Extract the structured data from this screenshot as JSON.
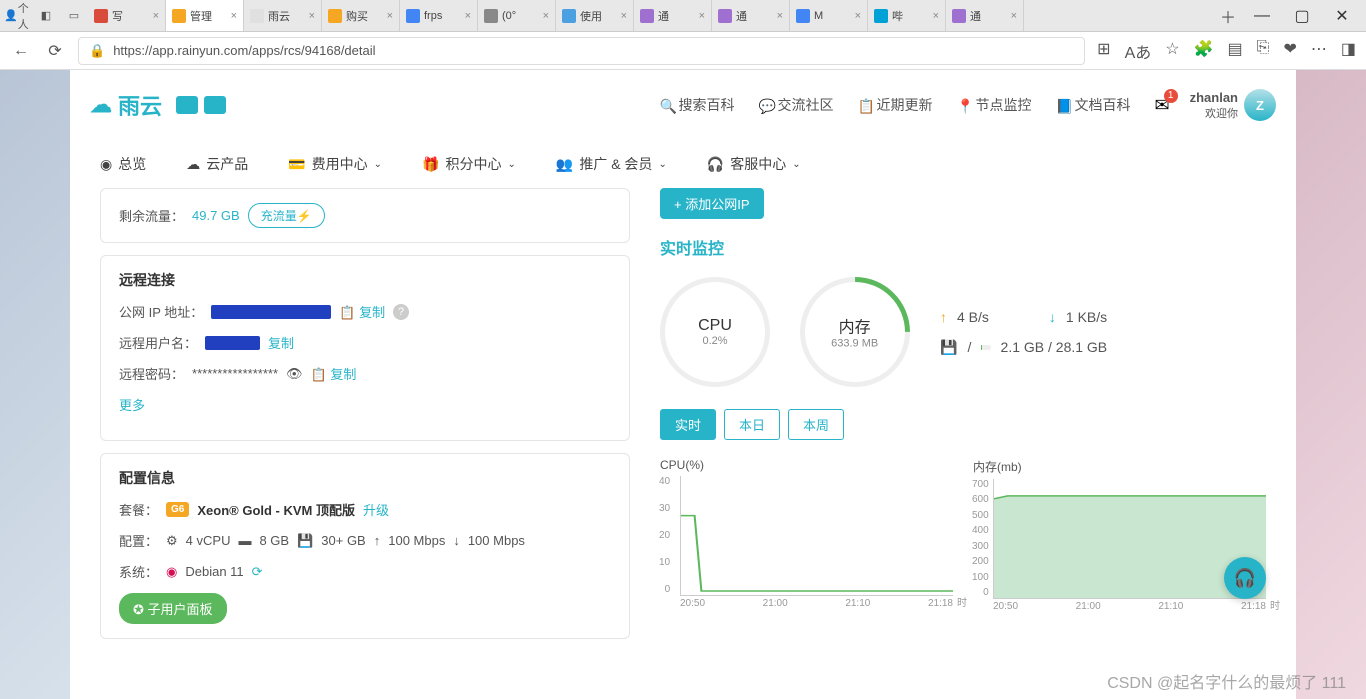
{
  "browser": {
    "profile": "个人",
    "tabs": [
      {
        "title": "写",
        "fav": "#d94b3b"
      },
      {
        "title": "管理",
        "fav": "#f5a623",
        "active": true
      },
      {
        "title": "雨云",
        "fav": "#e0e0e0"
      },
      {
        "title": "购买",
        "fav": "#f5a623"
      },
      {
        "title": "frps",
        "fav": "#4285f4"
      },
      {
        "title": "(0°",
        "fav": "#888"
      },
      {
        "title": "使用",
        "fav": "#4aa0e0"
      },
      {
        "title": "通",
        "fav": "#a070d0"
      },
      {
        "title": "通",
        "fav": "#a070d0"
      },
      {
        "title": "M",
        "fav": "#4285f4"
      },
      {
        "title": "哔",
        "fav": "#00a1d6"
      },
      {
        "title": "通",
        "fav": "#a070d0"
      }
    ],
    "url": "https://app.rainyun.com/apps/rcs/94168/detail"
  },
  "header": {
    "brand": "雨云",
    "links": [
      "搜索百科",
      "交流社区",
      "近期更新",
      "节点监控",
      "文档百科"
    ],
    "mailBadge": "1",
    "username": "zhanlan",
    "welcome": "欢迎你"
  },
  "subnav": [
    "总览",
    "云产品",
    "费用中心",
    "积分中心",
    "推广 & 会员",
    "客服中心"
  ],
  "left": {
    "traffic": {
      "label": "剩余流量：",
      "value": "49.7 GB",
      "btn": "充流量⚡"
    },
    "remote": {
      "title": "远程连接",
      "ipLabel": "公网 IP 地址：",
      "ipCopy": "复制",
      "userLabel": "远程用户名：",
      "userCopy": "复制",
      "pwdLabel": "远程密码：",
      "pwdMask": "*****************",
      "pwdCopy": "复制",
      "more": "更多"
    },
    "config": {
      "title": "配置信息",
      "planLabel": "套餐：",
      "g6": "G6",
      "planName": "Xeon® Gold - KVM 顶配版",
      "upgrade": "升级",
      "hwLabel": "配置：",
      "cpu": "4 vCPU",
      "ram": "8 GB",
      "disk": "30+ GB",
      "up": "100 Mbps",
      "down": "100 Mbps",
      "osLabel": "系统：",
      "osName": "Debian 11",
      "panelBtn": "✪ 子用户面板"
    }
  },
  "right": {
    "addIp": "+ 添加公网IP",
    "monitorTitle": "实时监控",
    "cpu": {
      "label": "CPU",
      "val": "0.2%"
    },
    "mem": {
      "label": "内存",
      "val": "633.9 MB"
    },
    "net": {
      "up": "4 B/s",
      "down": "1 KB/s"
    },
    "disk": {
      "icon": "💾",
      "sep": "/",
      "text": "2.1 GB / 28.1 GB"
    },
    "timeBtns": [
      "实时",
      "本日",
      "本周"
    ],
    "cpuChart": {
      "title": "CPU(%)",
      "y": [
        "40",
        "30",
        "20",
        "10",
        "0"
      ],
      "x": [
        "20:50",
        "21:00",
        "21:10",
        "21:18"
      ],
      "unit": "时"
    },
    "memChart": {
      "title": "内存(mb)",
      "y": [
        "700",
        "600",
        "500",
        "400",
        "300",
        "200",
        "100",
        "0"
      ],
      "x": [
        "20:50",
        "21:00",
        "21:10",
        "21:18"
      ],
      "unit": "时"
    }
  },
  "watermark": "CSDN @起名字什么的最烦了 111",
  "chart_data": [
    {
      "type": "line",
      "title": "CPU(%)",
      "xlabel": "时",
      "ylabel": "",
      "ylim": [
        0,
        40
      ],
      "x": [
        "20:48",
        "20:50",
        "20:52",
        "21:00",
        "21:10",
        "21:18"
      ],
      "values": [
        27,
        27,
        1,
        1,
        1,
        1
      ]
    },
    {
      "type": "area",
      "title": "内存(mb)",
      "xlabel": "时",
      "ylabel": "",
      "ylim": [
        0,
        700
      ],
      "x": [
        "20:48",
        "20:50",
        "21:00",
        "21:10",
        "21:18"
      ],
      "values": [
        600,
        600,
        605,
        605,
        605
      ]
    }
  ]
}
